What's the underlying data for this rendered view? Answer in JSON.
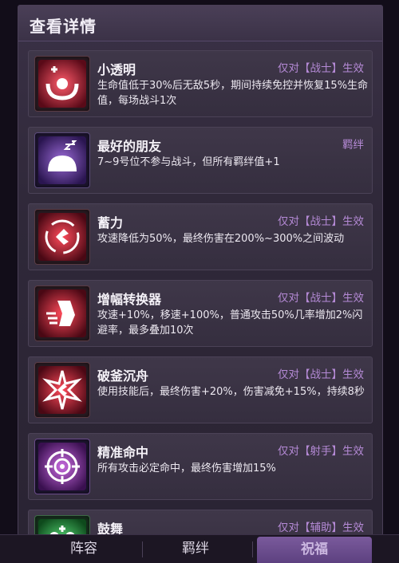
{
  "panel": {
    "title": "查看详情"
  },
  "items": [
    {
      "name": "小透明",
      "tag": "仅对【战士】生效",
      "desc": "生命值低于30%后无敌5秒，期间持续免控并恢复15%生命值，每场战斗1次",
      "icon": "invincible-icon"
    },
    {
      "name": "最好的朋友",
      "tag": "羁绊",
      "desc": "7~9号位不参与战斗，但所有羁绊值+1",
      "icon": "sleeping-blob-icon"
    },
    {
      "name": "蓄力",
      "tag": "仅对【战士】生效",
      "desc": "攻速降低为50%，最终伤害在200%~300%之间波动",
      "icon": "charge-swirl-icon"
    },
    {
      "name": "增幅转换器",
      "tag": "仅对【战士】生效",
      "desc": "攻速+10%，移速+100%，普通攻击50%几率增加2%闪避率，最多叠加10次",
      "icon": "speed-boot-icon"
    },
    {
      "name": "破釜沉舟",
      "tag": "仅对【战士】生效",
      "desc": "使用技能后，最终伤害+20%，伤害减免+15%，持续8秒",
      "icon": "burst-icon"
    },
    {
      "name": "精准命中",
      "tag": "仅对【射手】生效",
      "desc": "所有攻击必定命中，最终伤害增加15%",
      "icon": "crosshair-icon"
    },
    {
      "name": "鼓舞",
      "tag": "仅对【辅助】生效",
      "desc": "",
      "icon": "cheer-icon"
    }
  ],
  "tabs": [
    {
      "label": "阵容"
    },
    {
      "label": "羁绊"
    },
    {
      "label": "祝福",
      "selected": true
    }
  ],
  "colors": {
    "tag": "#b58ad6",
    "background": "#120d19",
    "selected_tab": "#6b4d8e"
  }
}
